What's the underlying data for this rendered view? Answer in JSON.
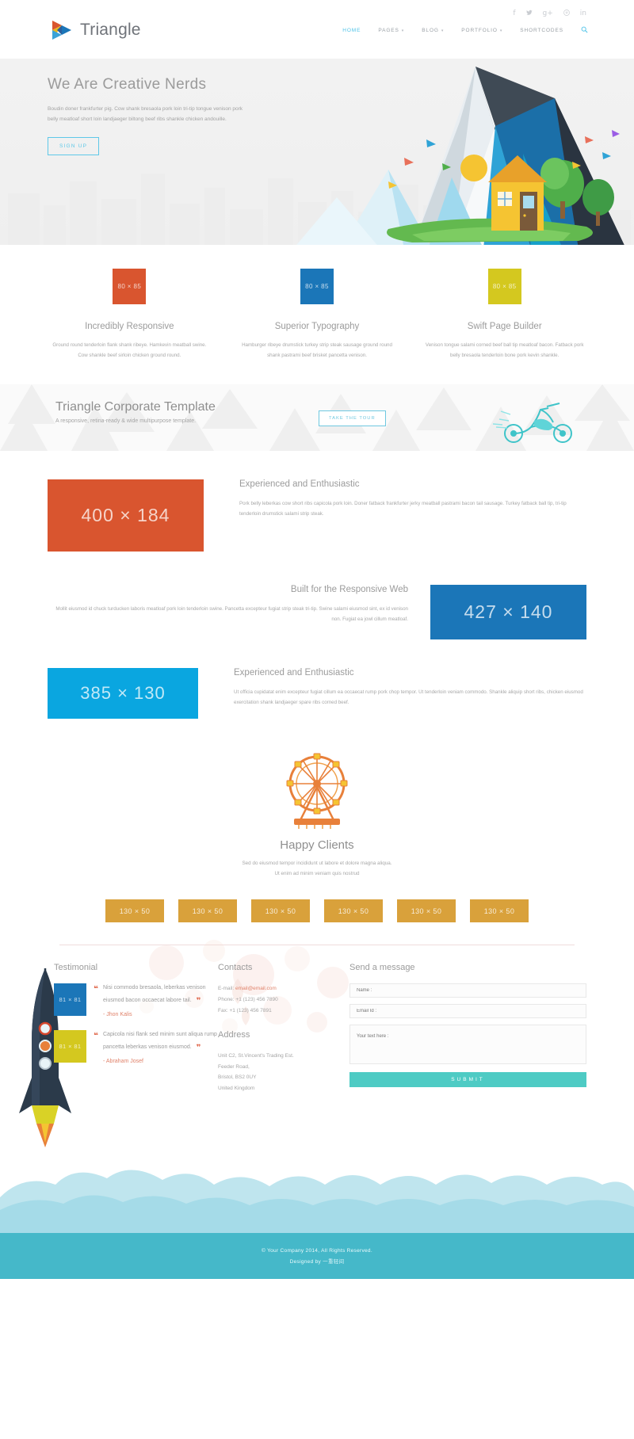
{
  "header": {
    "logo_text": "Triangle",
    "social": [
      {
        "name": "facebook-icon",
        "glyph": "f"
      },
      {
        "name": "twitter-icon",
        "glyph": "ᵗ"
      },
      {
        "name": "google-plus-icon",
        "glyph": "g+"
      },
      {
        "name": "pinterest-icon",
        "glyph": "Ⓟ"
      },
      {
        "name": "linkedin-icon",
        "glyph": "in"
      }
    ],
    "nav": [
      {
        "label": "HOME",
        "caret": "",
        "active": true
      },
      {
        "label": "PAGES",
        "caret": "▾",
        "active": false
      },
      {
        "label": "BLOG",
        "caret": "▾",
        "active": false
      },
      {
        "label": "PORTFOLIO",
        "caret": "▾",
        "active": false
      },
      {
        "label": "SHORTCODES",
        "caret": "",
        "active": false
      }
    ],
    "search_icon": "⌕"
  },
  "hero": {
    "title": "We Are Creative Nerds",
    "text": "Boudin doner frankfurter pig. Cow shank bresaola pork loin tri-tip tongue venison pork belly meatloaf short loin landjaeger biltong beef ribs shankle chicken andouille.",
    "button": "SIGN UP"
  },
  "features": [
    {
      "placeholder": "80 × 85",
      "color": "#d9552f",
      "title": "Incredibly Responsive",
      "text": "Ground round tenderloin flank shank ribeye. Hamkevin meatball swine. Cow shankle beef sirloin chicken ground round."
    },
    {
      "placeholder": "80 × 85",
      "color": "#1b76b8",
      "title": "Superior Typography",
      "text": "Hamburger ribeye drumstick turkey strip steak sausage ground round shank pastrami beef brisket pancetta venison."
    },
    {
      "placeholder": "80 × 85",
      "color": "#d4c81f",
      "title": "Swift Page Builder",
      "text": "Venison tongue salami corned beef ball tip meatloaf bacon. Fatback pork belly bresaola tenderloin bone pork kevin shankle."
    }
  ],
  "band": {
    "title": "Triangle Corporate Template",
    "subtitle": "A responsive, retina-ready & wide multipurpose template.",
    "button": "TAKE THE TOUR"
  },
  "sections": [
    {
      "placeholder": "400 × 184",
      "color": "#d9552f",
      "title": "Experienced and Enthusiastic",
      "text": "Pork belly leberkas cow short ribs capicola pork loin. Doner fatback frankfurter jerky meatball pastrami bacon tail sausage. Turkey fatback ball tip, tri-tip tenderloin drumstick salami strip steak."
    },
    {
      "placeholder": "427 × 140",
      "color": "#1b76b8",
      "title": "Built for the Responsive Web",
      "text": "Mollit eiusmod id chuck turducken laboris meatloaf pork loin tenderloin swine. Pancetta excepteur fugiat strip steak tri-tip. Swine salami eiusmod sint, ex id venison non. Fugiat ea jowl cillum meatloaf."
    },
    {
      "placeholder": "385 × 130",
      "color": "#0aa6e0",
      "title": "Experienced and Enthusiastic",
      "text": "Ut officia cupidatat enim excepteur fugiat cillum ea occaecat rump pork chop tempor. Ut tenderloin veniam commodo. Shankle aliquip short ribs, chicken eiusmod exercitation shank landjaeger spare ribs corned beef."
    }
  ],
  "clients": {
    "title": "Happy Clients",
    "subtitle": "Sed do eiusmod tempor incididunt ut labore et dolore magna aliqua.\nUt enim ad minim veniam quis nostrud",
    "logos": [
      "130 × 50",
      "130 × 50",
      "130 × 50",
      "130 × 50",
      "130 × 50",
      "130 × 50"
    ]
  },
  "footer": {
    "testimonial": {
      "title": "Testimonial",
      "items": [
        {
          "placeholder": "81 × 81",
          "color": "#1b76b8",
          "quote": "Nisi commodo bresaola, leberkas venison eiusmod bacon occaecat labore tail.",
          "author": "- Jhon Kalis"
        },
        {
          "placeholder": "81 × 81",
          "color": "#d4c81f",
          "quote": "Capicola nisi flank sed minim sunt aliqua rump pancetta leberkas venison eiusmod.",
          "author": "- Abraham Josef"
        }
      ]
    },
    "contacts": {
      "title": "Contacts",
      "email_label": "E-mail:",
      "email_value": "email@email.com",
      "phone": "Phone: +1 (123) 456 7890",
      "fax": "Fax: +1 (123) 456 7891",
      "address_title": "Address",
      "address_lines": [
        "Unit C2, St.Vincent's Trading Est.",
        "Feeder Road,",
        "Bristol, BS2 0UY",
        "United Kingdom"
      ]
    },
    "message": {
      "title": "Send a message",
      "name_placeholder": "Name :",
      "email_placeholder": "Email Id :",
      "text_placeholder": "Your text here :",
      "submit": "SUBMIT"
    },
    "bottom": {
      "copyright": "© Your Company 2014, All Rights Reserved.",
      "designed_prefix": "Designed by ",
      "designed_link": "一重轻间"
    }
  },
  "colors": {
    "accent_cyan": "#4fc3e8",
    "teal": "#4ecbc4",
    "footer_bar": "#45b8c9",
    "orange": "#d9552f",
    "blue": "#1b76b8",
    "yellow": "#d4c81f",
    "gold": "#d9a13b"
  }
}
